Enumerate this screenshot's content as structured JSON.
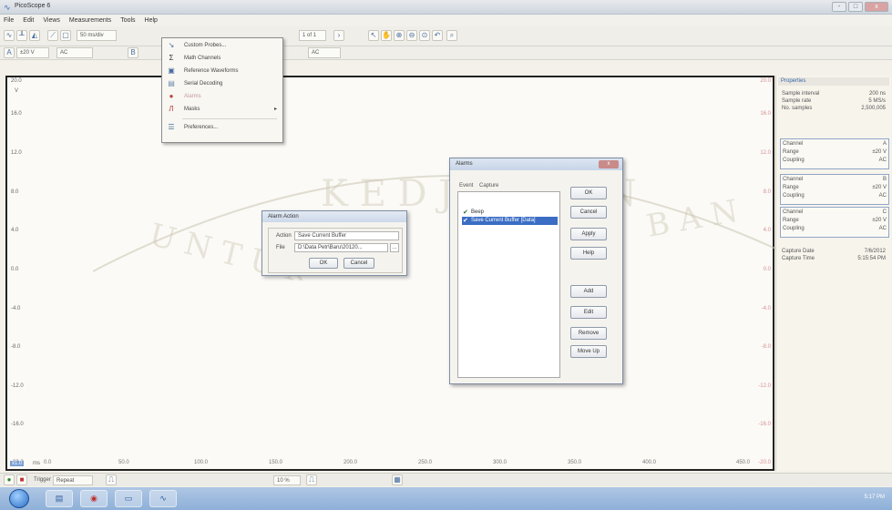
{
  "window": {
    "title": "PicoScope 6",
    "close_label": "x",
    "minimize_label": "-",
    "maximize_label": "□"
  },
  "menubar": [
    "File",
    "Edit",
    "Views",
    "Measurements",
    "Tools",
    "Help"
  ],
  "toolbar": {
    "timebase": "50 ms/div",
    "capture_count": "1 of 1",
    "channel_a_range": "±20 V",
    "channel_a_coupling": "AC",
    "channel_b_coupling": "AC"
  },
  "tools_menu": {
    "items": [
      {
        "label": "Custom Probes...",
        "icon": "probe-icon"
      },
      {
        "label": "Math Channels",
        "icon": "sigma-icon"
      },
      {
        "label": "Reference Waveforms",
        "icon": "reference-icon"
      },
      {
        "label": "Serial Decoding",
        "icon": "serial-icon"
      },
      {
        "label": "Alarms",
        "icon": "alarm-icon"
      },
      {
        "label": "Masks",
        "icon": "mask-icon",
        "submenu": true
      },
      {
        "label": "Preferences...",
        "icon": "preferences-icon"
      }
    ]
  },
  "scope": {
    "left_unit": "V",
    "y_ticks": [
      "20.0",
      "16.0",
      "12.0",
      "8.0",
      "4.0",
      "0.0",
      "-4.0",
      "-8.0",
      "-12.0",
      "-16.0",
      "-20.0"
    ],
    "x_ticks": [
      "0.0",
      "50.0",
      "100.0",
      "150.0",
      "200.0",
      "250.0",
      "300.0",
      "350.0",
      "400.0",
      "450.0"
    ],
    "x_unit": "ms",
    "x_scale_label": "x1.0"
  },
  "properties": {
    "header": "Properties",
    "rows": [
      {
        "label": "Sample interval",
        "value": "200 ns"
      },
      {
        "label": "Sample rate",
        "value": "5 MS/s"
      },
      {
        "label": "No. samples",
        "value": "2,500,005"
      }
    ],
    "channels": [
      {
        "channel": "A",
        "range": "±20 V",
        "coupling": "AC"
      },
      {
        "channel": "B",
        "range": "±20 V",
        "coupling": "AC"
      },
      {
        "channel": "C",
        "range": "±20 V",
        "coupling": "AC"
      }
    ],
    "labels": {
      "channel": "Channel",
      "range": "Range",
      "coupling": "Coupling"
    },
    "capture_date_label": "Capture Date",
    "capture_date": "7/6/2012",
    "capture_time_label": "Capture Time",
    "capture_time": "5:15:54 PM"
  },
  "alarms_dialog": {
    "title": "Alarms",
    "close_label": "x",
    "tabs": [
      "Event",
      "Capture"
    ],
    "items": [
      {
        "label": "Beep",
        "checked": true,
        "selected": false
      },
      {
        "label": "Save Current Buffer [Data]",
        "checked": true,
        "selected": true
      }
    ],
    "buttons": [
      "OK",
      "Cancel",
      "Apply",
      "Help",
      "Add",
      "Edit",
      "Remove",
      "Move Up"
    ]
  },
  "alarm_action_dialog": {
    "title": "Alarm Action",
    "action_label": "Action",
    "action_value": "Save Current Buffer",
    "file_label": "File",
    "file_value": "D:\\Data Petr\\Baru\\20120...",
    "ok_label": "OK",
    "cancel_label": "Cancel"
  },
  "statusbar": {
    "trigger_label": "Trigger",
    "trigger_mode": "Repeat",
    "zoom": "10 %"
  },
  "taskbar": {
    "time": "5:17 PM"
  },
  "watermark": {
    "left_text": "UNTUK",
    "middle_text": "KEDJAJAAN",
    "right_text": "BAN"
  },
  "colors": {
    "frame_border": "#222222",
    "selection": "#3b6dc4",
    "channel_b_axis": "#d88f8f",
    "channel_a_axis": "#9bb0d4"
  }
}
